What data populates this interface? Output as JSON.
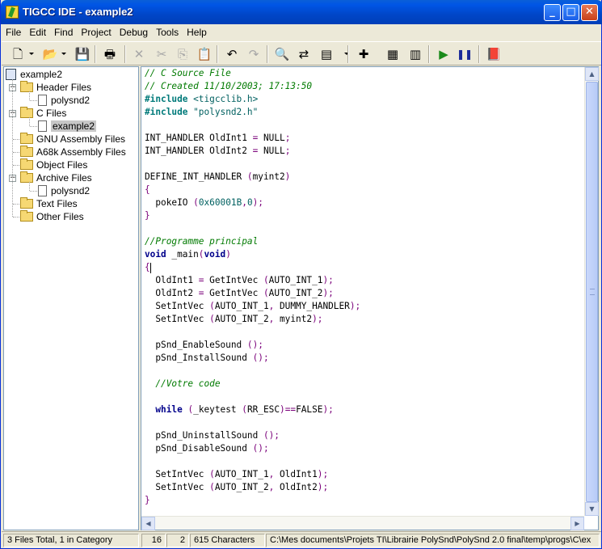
{
  "window": {
    "title": "TIGCC IDE - example2"
  },
  "menu": [
    "File",
    "Edit",
    "Find",
    "Project",
    "Debug",
    "Tools",
    "Help"
  ],
  "toolbar": {
    "buttons": [
      {
        "name": "new-file-icon",
        "glyph": "🗋"
      },
      {
        "name": "open-icon",
        "glyph": "📂"
      },
      {
        "name": "save-icon",
        "glyph": "💾"
      },
      {
        "name": "print-icon",
        "glyph": "🖶"
      },
      {
        "name": "delete-icon",
        "glyph": "✕"
      },
      {
        "name": "cut-icon",
        "glyph": "✂"
      },
      {
        "name": "copy-icon",
        "glyph": "⎘"
      },
      {
        "name": "paste-icon",
        "glyph": "📋"
      },
      {
        "name": "undo-icon",
        "glyph": "↶"
      },
      {
        "name": "redo-icon",
        "glyph": "↷"
      },
      {
        "name": "find-icon",
        "glyph": "🔍"
      },
      {
        "name": "replace-icon",
        "glyph": "⇄"
      },
      {
        "name": "find-function-icon",
        "glyph": "▤"
      },
      {
        "name": "add-file-icon",
        "glyph": "✚"
      },
      {
        "name": "compile-icon",
        "glyph": "▦"
      },
      {
        "name": "make-icon",
        "glyph": "▥"
      },
      {
        "name": "run-icon",
        "glyph": "▶"
      },
      {
        "name": "pause-icon",
        "glyph": "❚❚"
      },
      {
        "name": "help-book-icon",
        "glyph": "📕"
      }
    ]
  },
  "tree": {
    "project": "example2",
    "items": [
      {
        "label": "Header Files",
        "kind": "folder",
        "level": 1
      },
      {
        "label": "polysnd2",
        "kind": "file",
        "level": 2
      },
      {
        "label": "C Files",
        "kind": "folder",
        "level": 1
      },
      {
        "label": "example2",
        "kind": "file",
        "level": 2,
        "selected": true
      },
      {
        "label": "GNU Assembly Files",
        "kind": "folder",
        "level": 1
      },
      {
        "label": "A68k Assembly Files",
        "kind": "folder",
        "level": 1
      },
      {
        "label": "Object Files",
        "kind": "folder",
        "level": 1
      },
      {
        "label": "Archive Files",
        "kind": "folder",
        "level": 1
      },
      {
        "label": "polysnd2",
        "kind": "file",
        "level": 2
      },
      {
        "label": "Text Files",
        "kind": "folder",
        "level": 1
      },
      {
        "label": "Other Files",
        "kind": "folder",
        "level": 1
      }
    ]
  },
  "code": [
    [
      [
        "cm",
        "// C Source File"
      ]
    ],
    [
      [
        "cm",
        "// Created 11/10/2003; 17:13:50"
      ]
    ],
    [
      [
        "pp",
        "#include "
      ],
      [
        "st",
        "<tigcclib.h>"
      ]
    ],
    [
      [
        "pp",
        "#include "
      ],
      [
        "st",
        "\"polysnd2.h\""
      ]
    ],
    [],
    [
      [
        "t",
        "INT_HANDLER OldInt1 "
      ],
      [
        "br",
        "="
      ],
      [
        "t",
        " NULL"
      ],
      [
        "br",
        ";"
      ]
    ],
    [
      [
        "t",
        "INT_HANDLER OldInt2 "
      ],
      [
        "br",
        "="
      ],
      [
        "t",
        " NULL"
      ],
      [
        "br",
        ";"
      ]
    ],
    [],
    [
      [
        "t",
        "DEFINE_INT_HANDLER "
      ],
      [
        "br",
        "("
      ],
      [
        "t",
        "myint2"
      ],
      [
        "br",
        ")"
      ]
    ],
    [
      [
        "br",
        "{"
      ]
    ],
    [
      [
        "t",
        "  pokeIO "
      ],
      [
        "br",
        "("
      ],
      [
        "st",
        "0x60001B"
      ],
      [
        "br",
        ","
      ],
      [
        "st",
        "0"
      ],
      [
        "br",
        ");"
      ]
    ],
    [
      [
        "br",
        "}"
      ]
    ],
    [],
    [
      [
        "cm",
        "//Programme principal"
      ]
    ],
    [
      [
        "kw",
        "void"
      ],
      [
        "t",
        " _main"
      ],
      [
        "br",
        "("
      ],
      [
        "kw",
        "void"
      ],
      [
        "br",
        ")"
      ]
    ],
    [
      [
        "br",
        "{"
      ],
      [
        "caret",
        ""
      ]
    ],
    [
      [
        "t",
        "  OldInt1 "
      ],
      [
        "br",
        "="
      ],
      [
        "t",
        " GetIntVec "
      ],
      [
        "br",
        "("
      ],
      [
        "t",
        "AUTO_INT_1"
      ],
      [
        "br",
        ");"
      ]
    ],
    [
      [
        "t",
        "  OldInt2 "
      ],
      [
        "br",
        "="
      ],
      [
        "t",
        " GetIntVec "
      ],
      [
        "br",
        "("
      ],
      [
        "t",
        "AUTO_INT_2"
      ],
      [
        "br",
        ");"
      ]
    ],
    [
      [
        "t",
        "  SetIntVec "
      ],
      [
        "br",
        "("
      ],
      [
        "t",
        "AUTO_INT_1"
      ],
      [
        "br",
        ","
      ],
      [
        "t",
        " DUMMY_HANDLER"
      ],
      [
        "br",
        ");"
      ]
    ],
    [
      [
        "t",
        "  SetIntVec "
      ],
      [
        "br",
        "("
      ],
      [
        "t",
        "AUTO_INT_2"
      ],
      [
        "br",
        ","
      ],
      [
        "t",
        " myint2"
      ],
      [
        "br",
        ");"
      ]
    ],
    [],
    [
      [
        "t",
        "  pSnd_EnableSound "
      ],
      [
        "br",
        "();"
      ]
    ],
    [
      [
        "t",
        "  pSnd_InstallSound "
      ],
      [
        "br",
        "();"
      ]
    ],
    [],
    [
      [
        "t",
        "  "
      ],
      [
        "cm",
        "//Votre code"
      ]
    ],
    [],
    [
      [
        "t",
        "  "
      ],
      [
        "kw",
        "while"
      ],
      [
        "t",
        " "
      ],
      [
        "br",
        "("
      ],
      [
        "t",
        "_keytest "
      ],
      [
        "br",
        "("
      ],
      [
        "t",
        "RR_ESC"
      ],
      [
        "br",
        ")=="
      ],
      [
        "t",
        "FALSE"
      ],
      [
        "br",
        ");"
      ]
    ],
    [],
    [
      [
        "t",
        "  pSnd_UninstallSound "
      ],
      [
        "br",
        "();"
      ]
    ],
    [
      [
        "t",
        "  pSnd_DisableSound "
      ],
      [
        "br",
        "();"
      ]
    ],
    [],
    [
      [
        "t",
        "  SetIntVec "
      ],
      [
        "br",
        "("
      ],
      [
        "t",
        "AUTO_INT_1"
      ],
      [
        "br",
        ","
      ],
      [
        "t",
        " OldInt1"
      ],
      [
        "br",
        ");"
      ]
    ],
    [
      [
        "t",
        "  SetIntVec "
      ],
      [
        "br",
        "("
      ],
      [
        "t",
        "AUTO_INT_2"
      ],
      [
        "br",
        ","
      ],
      [
        "t",
        " OldInt2"
      ],
      [
        "br",
        ");"
      ]
    ],
    [
      [
        "br",
        "}"
      ]
    ]
  ],
  "status": {
    "files": "3 Files Total, 1 in Category",
    "line": "16",
    "col": "2",
    "chars": "615 Characters",
    "path": "C:\\Mes documents\\Projets TI\\Librairie PolySnd\\PolySnd 2.0 final\\temp\\progs\\C\\ex"
  }
}
